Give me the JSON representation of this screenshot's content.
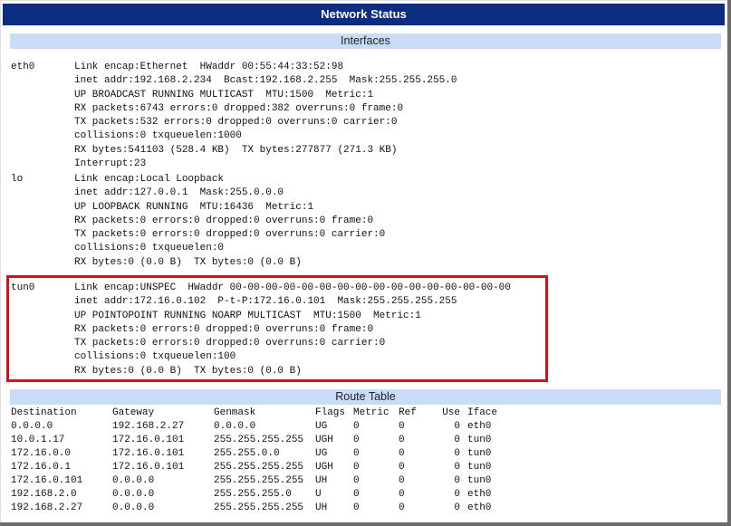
{
  "window": {
    "title": "Network Status"
  },
  "interfaces_header": "Interfaces",
  "interfaces": [
    {
      "name": "eth0",
      "lines": [
        "Link encap:Ethernet  HWaddr 00:55:44:33:52:98",
        "inet addr:192.168.2.234  Bcast:192.168.2.255  Mask:255.255.255.0",
        "UP BROADCAST RUNNING MULTICAST  MTU:1500  Metric:1",
        "RX packets:6743 errors:0 dropped:382 overruns:0 frame:0",
        "TX packets:532 errors:0 dropped:0 overruns:0 carrier:0",
        "collisions:0 txqueuelen:1000",
        "RX bytes:541103 (528.4 KB)  TX bytes:277877 (271.3 KB)",
        "Interrupt:23"
      ]
    },
    {
      "name": "lo",
      "lines": [
        "Link encap:Local Loopback",
        "inet addr:127.0.0.1  Mask:255.0.0.0",
        "UP LOOPBACK RUNNING  MTU:16436  Metric:1",
        "RX packets:0 errors:0 dropped:0 overruns:0 frame:0",
        "TX packets:0 errors:0 dropped:0 overruns:0 carrier:0",
        "collisions:0 txqueuelen:0",
        "RX bytes:0 (0.0 B)  TX bytes:0 (0.0 B)"
      ]
    },
    {
      "name": "tun0",
      "lines": [
        "Link encap:UNSPEC  HWaddr 00-00-00-00-00-00-00-00-00-00-00-00-00-00-00-00",
        "inet addr:172.16.0.102  P-t-P:172.16.0.101  Mask:255.255.255.255",
        "UP POINTOPOINT RUNNING NOARP MULTICAST  MTU:1500  Metric:1",
        "RX packets:0 errors:0 dropped:0 overruns:0 frame:0",
        "TX packets:0 errors:0 dropped:0 overruns:0 carrier:0",
        "collisions:0 txqueuelen:100",
        "RX bytes:0 (0.0 B)  TX bytes:0 (0.0 B)"
      ]
    }
  ],
  "route_header": "Route Table",
  "route_table": {
    "columns": [
      "Destination",
      "Gateway",
      "Genmask",
      "Flags",
      "Metric",
      "Ref",
      "Use",
      "Iface"
    ],
    "rows": [
      [
        "0.0.0.0",
        "192.168.2.27",
        "0.0.0.0",
        "UG",
        "0",
        "0",
        "0",
        "eth0"
      ],
      [
        "10.0.1.17",
        "172.16.0.101",
        "255.255.255.255",
        "UGH",
        "0",
        "0",
        "0",
        "tun0"
      ],
      [
        "172.16.0.0",
        "172.16.0.101",
        "255.255.0.0",
        "UG",
        "0",
        "0",
        "0",
        "tun0"
      ],
      [
        "172.16.0.1",
        "172.16.0.101",
        "255.255.255.255",
        "UGH",
        "0",
        "0",
        "0",
        "tun0"
      ],
      [
        "172.16.0.101",
        "0.0.0.0",
        "255.255.255.255",
        "UH",
        "0",
        "0",
        "0",
        "tun0"
      ],
      [
        "192.168.2.0",
        "0.0.0.0",
        "255.255.255.0",
        "U",
        "0",
        "0",
        "0",
        "eth0"
      ],
      [
        "192.168.2.27",
        "0.0.0.0",
        "255.255.255.255",
        "UH",
        "0",
        "0",
        "0",
        "eth0"
      ]
    ]
  },
  "highlight_color": "#d91018",
  "title_bar_color": "#0b2c80",
  "section_bar_color": "#c8dcf8"
}
